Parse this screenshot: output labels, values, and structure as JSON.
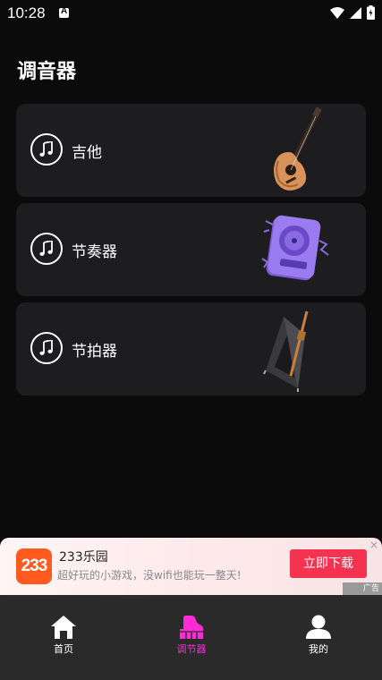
{
  "status_bar": {
    "time": "10:28"
  },
  "header": {
    "title": "调音器"
  },
  "cards": [
    {
      "label": "吉他",
      "art": "guitar-image"
    },
    {
      "label": "节奏器",
      "art": "rhythm-box-image"
    },
    {
      "label": "节拍器",
      "art": "metronome-image"
    }
  ],
  "ad": {
    "logo_text": "233",
    "title": "233乐园",
    "description": "超好玩的小游戏，没wifi也能玩一整天!",
    "button_label": "立即下载",
    "close_symbol": "×",
    "tag": "广告"
  },
  "nav": {
    "items": [
      {
        "label": "首页",
        "icon": "home-icon"
      },
      {
        "label": "调节器",
        "icon": "piano-icon"
      },
      {
        "label": "我的",
        "icon": "user-icon"
      }
    ],
    "active_color": "#ff2bd6"
  }
}
